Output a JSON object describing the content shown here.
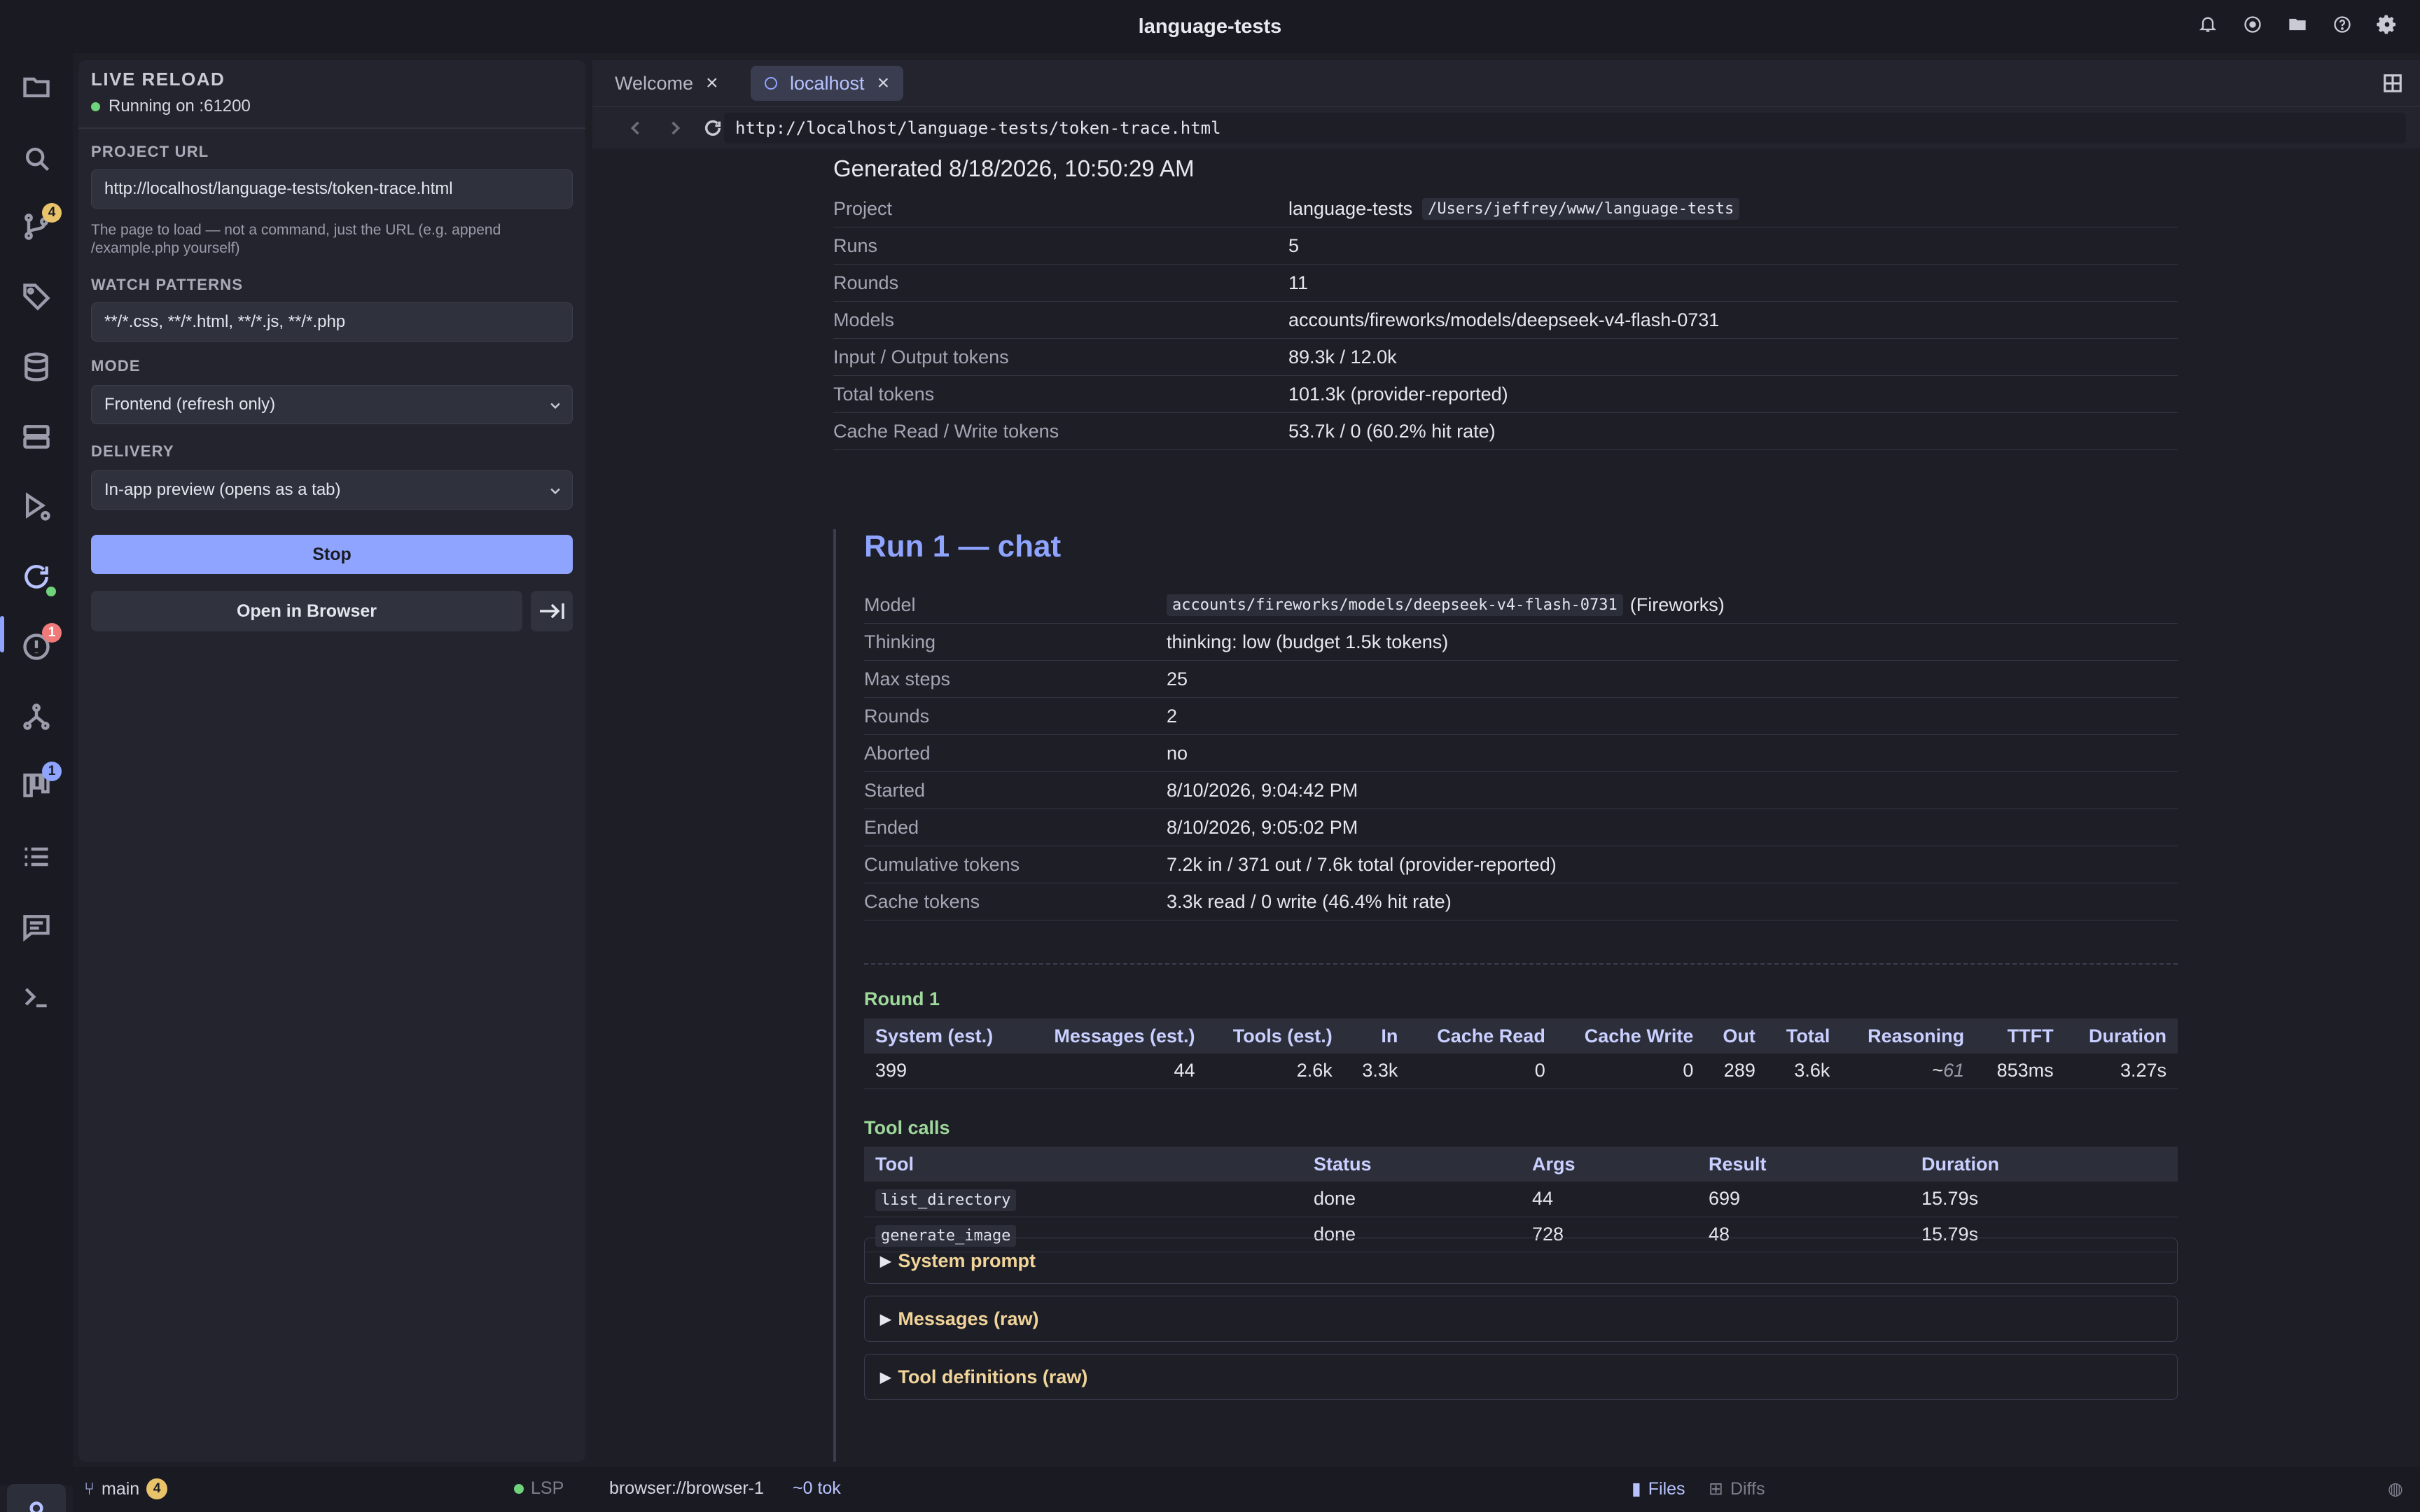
{
  "window": {
    "title": "language-tests"
  },
  "title_icons": [
    "bell-icon",
    "record-icon",
    "folder-icon",
    "help-icon",
    "settings-icon"
  ],
  "activity_bar": {
    "items": [
      {
        "name": "explorer-icon"
      },
      {
        "name": "search-icon"
      },
      {
        "name": "source-control-icon",
        "badge": "4"
      },
      {
        "name": "tags-icon"
      },
      {
        "name": "database-icon"
      },
      {
        "name": "servers-icon"
      },
      {
        "name": "run-debug-icon"
      },
      {
        "name": "live-reload-icon",
        "active": true
      },
      {
        "name": "problems-icon",
        "badge": "1"
      },
      {
        "name": "git-graph-icon"
      },
      {
        "name": "kanban-icon",
        "badge": "1"
      },
      {
        "name": "tasks-icon"
      },
      {
        "name": "chat-icon"
      },
      {
        "name": "terminal-icon"
      }
    ],
    "account_icon": "user-icon"
  },
  "live_reload": {
    "header": "LIVE RELOAD",
    "status": "Running on :61200",
    "project_url_label": "PROJECT URL",
    "project_url_value": "http://localhost/language-tests/token-trace.html",
    "help_text": "The page to load — not a command, just the URL (e.g. append /example.php yourself)",
    "watch_label": "WATCH PATTERNS",
    "watch_value": "**/*.css, **/*.html, **/*.js, **/*.php",
    "mode_label": "MODE",
    "mode_value": "Frontend (refresh only)",
    "delivery_label": "DELIVERY",
    "delivery_value": "In-app preview (opens as a tab)",
    "stop_button": "Stop",
    "open_button": "Open in Browser"
  },
  "tabs": [
    {
      "label": "Welcome",
      "active": false
    },
    {
      "label": "localhost",
      "active": true
    }
  ],
  "browser": {
    "url": "http://localhost/language-tests/token-trace.html"
  },
  "report": {
    "generated": "Generated 8/18/2026, 10:50:29 AM",
    "summary": [
      {
        "k": "Project",
        "v": "language-tests",
        "code": "/Users/jeffrey/www/language-tests"
      },
      {
        "k": "Runs",
        "v": "5"
      },
      {
        "k": "Rounds",
        "v": "11"
      },
      {
        "k": "Models",
        "v": "accounts/fireworks/models/deepseek-v4-flash-0731"
      },
      {
        "k": "Input / Output tokens",
        "v": "89.3k / 12.0k"
      },
      {
        "k": "Total tokens",
        "v": "101.3k (provider-reported)"
      },
      {
        "k": "Cache Read / Write tokens",
        "v": "53.7k / 0 (60.2% hit rate)"
      }
    ],
    "run": {
      "title": "Run 1 — chat",
      "details": [
        {
          "k": "Model",
          "code": "accounts/fireworks/models/deepseek-v4-flash-0731",
          "v": "(Fireworks)"
        },
        {
          "k": "Thinking",
          "v": "thinking: low (budget 1.5k tokens)"
        },
        {
          "k": "Max steps",
          "v": "25"
        },
        {
          "k": "Rounds",
          "v": "2"
        },
        {
          "k": "Aborted",
          "v": "no"
        },
        {
          "k": "Started",
          "v": "8/10/2026, 9:04:42 PM"
        },
        {
          "k": "Ended",
          "v": "8/10/2026, 9:05:02 PM"
        },
        {
          "k": "Cumulative tokens",
          "v": "7.2k in / 371 out / 7.6k total (provider-reported)"
        },
        {
          "k": "Cache tokens",
          "v": "3.3k read / 0 write (46.4% hit rate)"
        }
      ],
      "round_title": "Round 1",
      "round_headers": [
        "System (est.)",
        "Messages (est.)",
        "Tools (est.)",
        "In",
        "Cache Read",
        "Cache Write",
        "Out",
        "Total",
        "Reasoning",
        "TTFT",
        "Duration"
      ],
      "round_row": [
        "399",
        "44",
        "2.6k",
        "3.3k",
        "0",
        "0",
        "289",
        "3.6k",
        "~",
        "61",
        "853ms",
        "3.27s"
      ],
      "tool_calls_title": "Tool calls",
      "tool_headers": [
        "Tool",
        "Status",
        "Args",
        "Result",
        "Duration"
      ],
      "tool_rows": [
        [
          "list_directory",
          "done",
          "44",
          "699",
          "15.79s"
        ],
        [
          "generate_image",
          "done",
          "728",
          "48",
          "15.79s"
        ]
      ],
      "collapsibles": [
        "System prompt",
        "Messages (raw)",
        "Tool definitions (raw)"
      ]
    }
  },
  "status_bar": {
    "branch": "main",
    "branch_badge": "4",
    "lsp": "LSP",
    "browser_id": "browser://browser-1",
    "tokens": "~0 tok",
    "files": "Files",
    "diffs": "Diffs"
  }
}
